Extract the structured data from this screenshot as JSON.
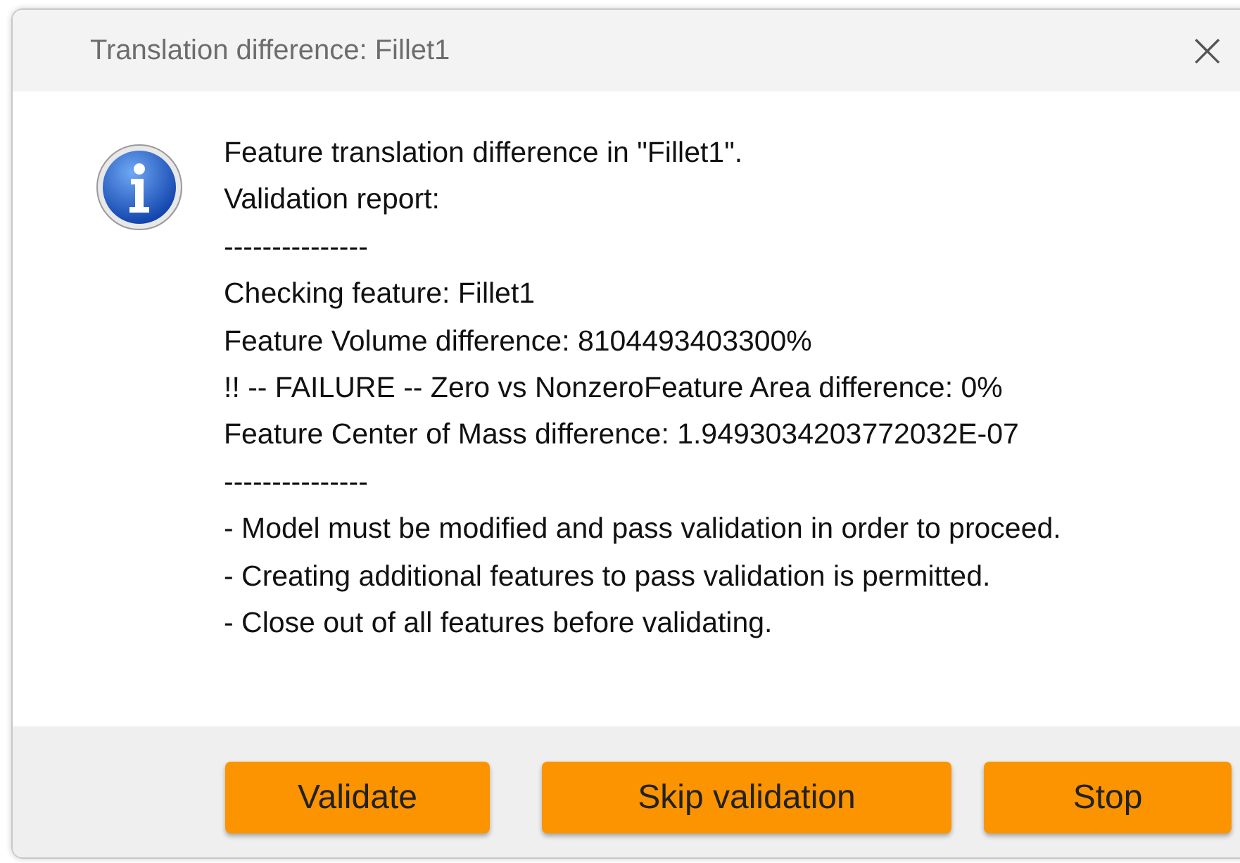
{
  "window": {
    "title": "Translation difference: Fillet1",
    "close": "×"
  },
  "message_lines": [
    "Feature translation difference in \"Fillet1\".",
    "Validation report:",
    "---------------",
    "Checking feature: Fillet1",
    "Feature Volume difference: 8104493403300%",
    "!! -- FAILURE -- Zero vs NonzeroFeature Area difference: 0%",
    "Feature Center of Mass difference: 1.9493034203772032E-07",
    "---------------",
    "- Model must be modified and pass validation in order to proceed.",
    "- Creating additional features to pass validation is permitted.",
    "- Close out of all features before validating."
  ],
  "buttons": [
    "Validate",
    "Skip validation",
    "Stop"
  ]
}
